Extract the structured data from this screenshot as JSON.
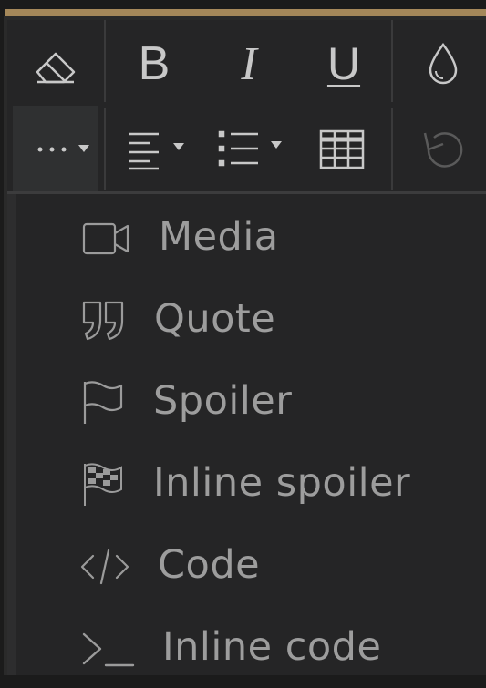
{
  "toolbar": {
    "row1": [
      {
        "name": "clear-formatting",
        "icon": "eraser-icon",
        "glyph": ""
      },
      {
        "name": "bold",
        "icon": "bold-icon",
        "glyph": "B"
      },
      {
        "name": "italic",
        "icon": "italic-icon",
        "glyph": "I"
      },
      {
        "name": "underline",
        "icon": "underline-icon",
        "glyph": "U"
      },
      {
        "name": "text-color",
        "icon": "droplet-icon",
        "glyph": ""
      }
    ],
    "row2": [
      {
        "name": "more-options",
        "icon": "ellipsis-icon",
        "active": true
      },
      {
        "name": "align",
        "icon": "align-left-icon"
      },
      {
        "name": "list",
        "icon": "list-icon"
      },
      {
        "name": "table",
        "icon": "table-icon"
      },
      {
        "name": "undo",
        "icon": "undo-icon",
        "disabled": true
      }
    ]
  },
  "menu": {
    "items": [
      {
        "label": "Media",
        "icon": "video-icon"
      },
      {
        "label": "Quote",
        "icon": "quote-icon"
      },
      {
        "label": "Spoiler",
        "icon": "flag-icon"
      },
      {
        "label": "Inline spoiler",
        "icon": "checkered-flag-icon"
      },
      {
        "label": "Code",
        "icon": "code-icon"
      },
      {
        "label": "Inline code",
        "icon": "terminal-icon"
      }
    ]
  },
  "colors": {
    "accent": "#a5885a",
    "icon": "#c8c8c8",
    "menu_text": "#9d9d9d",
    "background": "#252526"
  }
}
